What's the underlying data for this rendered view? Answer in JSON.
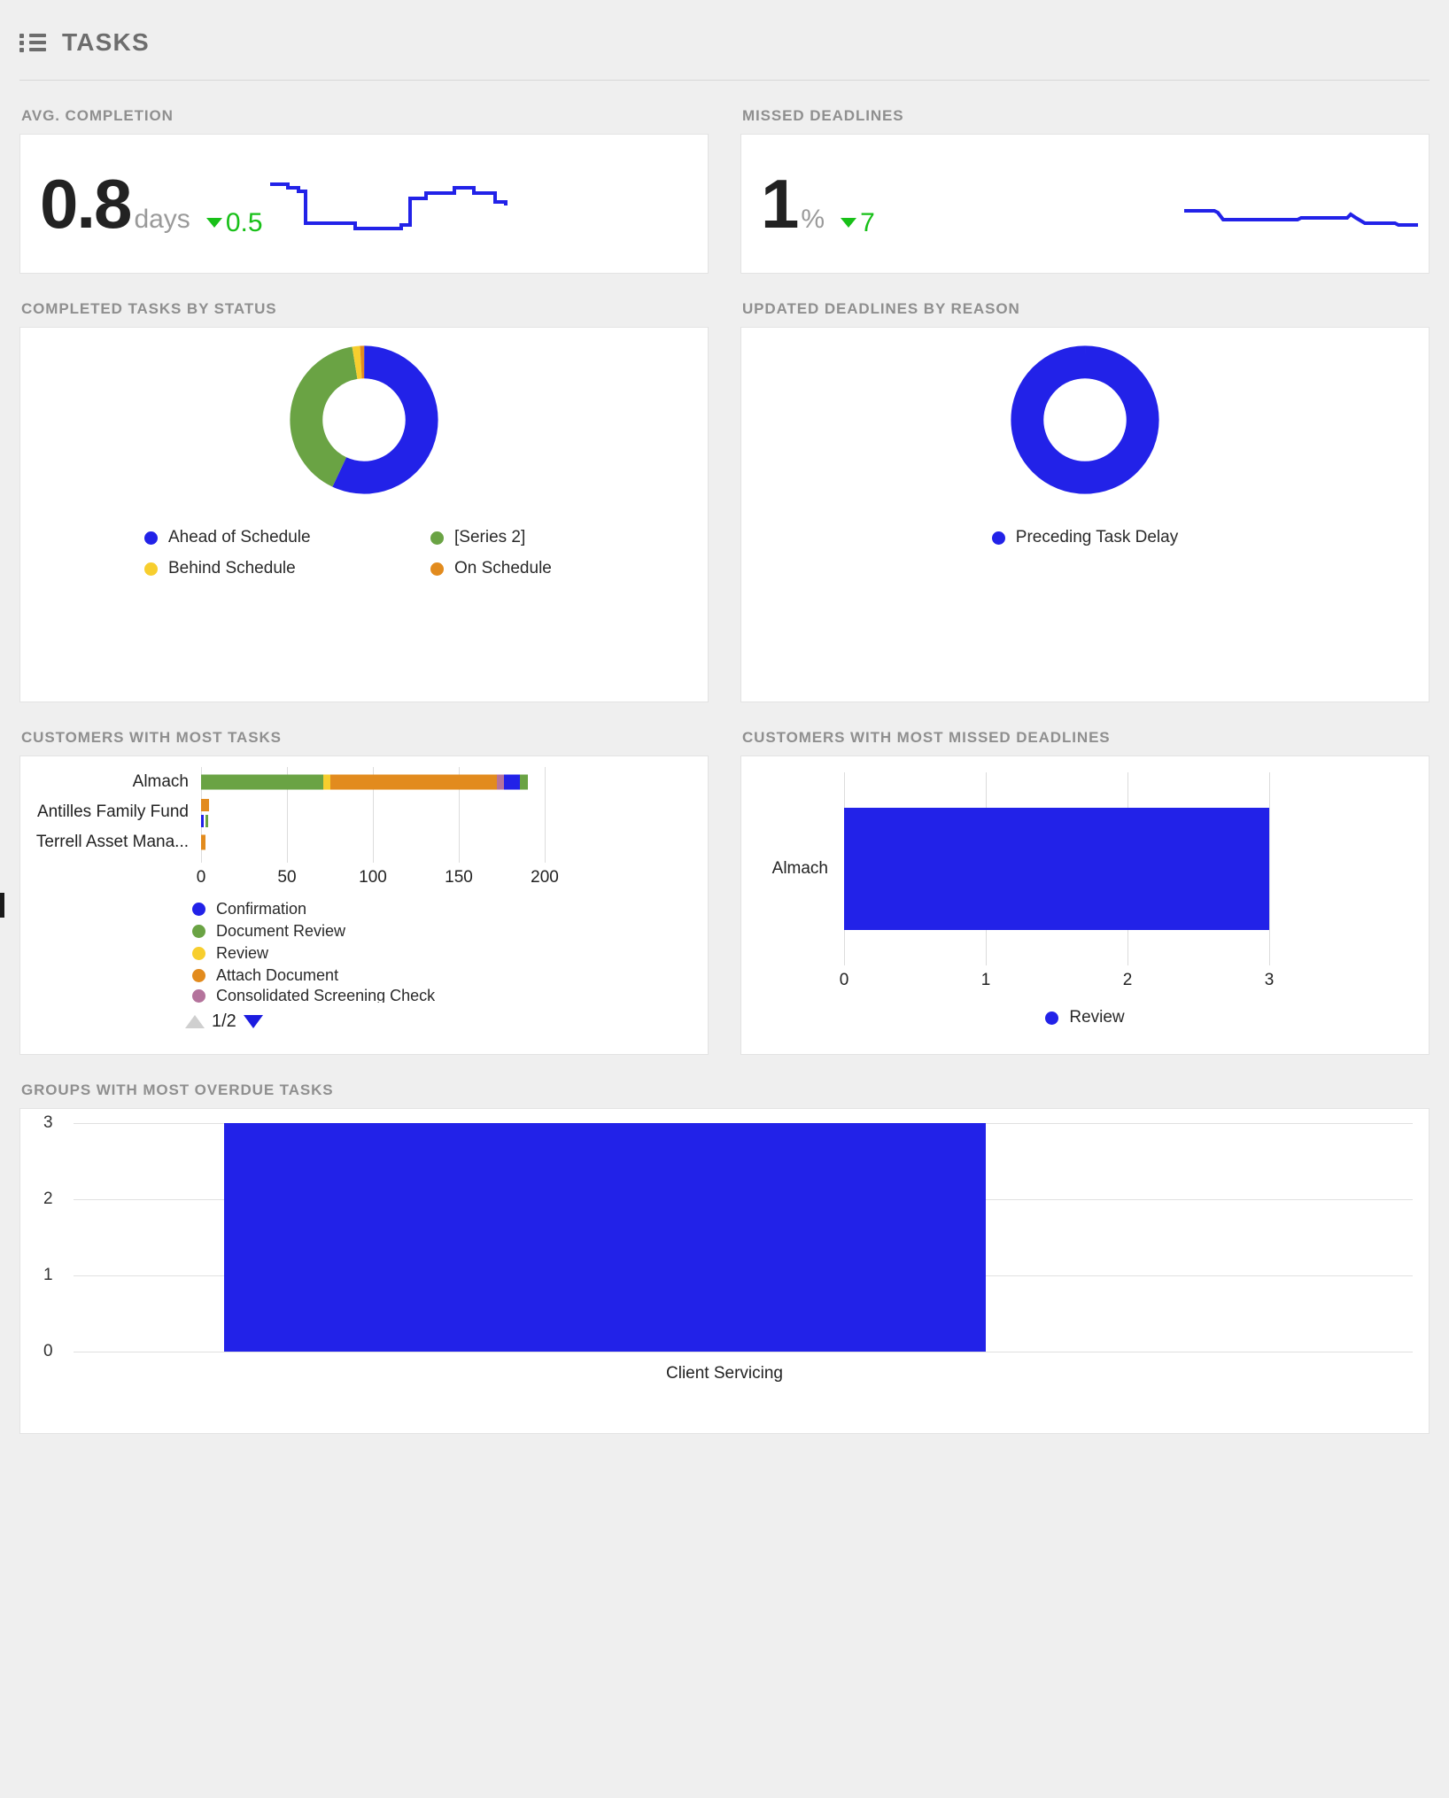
{
  "header": {
    "title": "TASKS",
    "icon": "list-icon"
  },
  "sections": {
    "avg_completion": "AVG. COMPLETION",
    "missed_deadlines": "MISSED DEADLINES",
    "completed_by_status": "COMPLETED TASKS BY STATUS",
    "updated_by_reason": "UPDATED DEADLINES BY REASON",
    "customers_most_tasks": "CUSTOMERS WITH MOST TASKS",
    "customers_most_missed": "CUSTOMERS WITH MOST MISSED DEADLINES",
    "groups_most_overdue": "GROUPS WITH MOST OVERDUE TASKS"
  },
  "kpi_avg_completion": {
    "value": "0.8",
    "unit": "days",
    "delta": "0.5",
    "delta_direction": "down",
    "delta_color": "#18c018"
  },
  "kpi_missed_deadlines": {
    "value": "1",
    "unit": "%",
    "delta": "7",
    "delta_direction": "down",
    "delta_color": "#18c018"
  },
  "colors": {
    "blue": "#2222e8",
    "green": "#66a council",
    "series_blue": "#2222e8",
    "series_green": "#6aa344",
    "series_yellow": "#f7ce2e",
    "series_orange": "#e28b1e",
    "series_mauve": "#b4739c",
    "grey": "#8f8f8f"
  },
  "chart_data": [
    {
      "id": "avg-completion-sparkline",
      "type": "line",
      "title": "AVG. COMPLETION",
      "xlabel": "",
      "ylabel": "",
      "grid": false,
      "legend": "none",
      "series": [
        {
          "name": "Avg. Completion",
          "color": "#2222e8",
          "values": [
            0.86,
            0.86,
            0.86,
            0.82,
            0.82,
            0.35,
            0.35,
            0.35,
            0.35,
            0.3,
            0.3,
            0.3,
            0.3,
            0.32,
            0.32,
            0.72,
            0.72,
            0.76,
            0.76,
            0.76,
            0.82,
            0.82,
            0.78,
            0.78,
            0.78,
            0.78,
            0.62,
            0.62,
            0.58,
            0.58,
            0.58,
            0.58
          ]
        }
      ],
      "ylim": [
        0.2,
        1.0
      ]
    },
    {
      "id": "missed-deadlines-sparkline",
      "type": "line",
      "title": "MISSED DEADLINES",
      "xlabel": "",
      "ylabel": "",
      "grid": false,
      "legend": "none",
      "series": [
        {
          "name": "Missed Deadlines",
          "color": "#2222e8",
          "values": [
            0.62,
            0.62,
            0.62,
            0.6,
            0.44,
            0.44,
            0.44,
            0.44,
            0.44,
            0.44,
            0.44,
            0.44,
            0.5,
            0.5,
            0.5,
            0.56,
            0.46,
            0.42,
            0.42,
            0.42,
            0.38,
            0.38,
            0.38,
            0.38
          ]
        }
      ],
      "ylim": [
        0,
        1
      ]
    },
    {
      "id": "completed-tasks-by-status",
      "type": "pie",
      "variant": "donut",
      "title": "COMPLETED TASKS BY STATUS",
      "legend": "bottom",
      "labels": [
        "Ahead of Schedule",
        "[Series 2]",
        "Behind Schedule",
        "On Schedule"
      ],
      "colors": [
        "#2222e8",
        "#6aa344",
        "#f7ce2e",
        "#e28b1e"
      ],
      "values": [
        57.0,
        40.4,
        1.7,
        0.9
      ]
    },
    {
      "id": "updated-deadlines-by-reason",
      "type": "pie",
      "variant": "donut",
      "title": "UPDATED DEADLINES BY REASON",
      "legend": "bottom",
      "labels": [
        "Preceding Task Delay"
      ],
      "colors": [
        "#2222e8"
      ],
      "values": [
        100
      ]
    },
    {
      "id": "customers-with-most-tasks",
      "type": "bar",
      "orientation": "horizontal",
      "stacked": true,
      "title": "CUSTOMERS WITH MOST TASKS",
      "xlabel": "",
      "ylabel": "",
      "categories": [
        "Almach",
        "Antilles Family Fund",
        "Terrell Asset Mana..."
      ],
      "xticks": [
        "0",
        "50",
        "100",
        "150",
        "200"
      ],
      "xlim": [
        0,
        200
      ],
      "legend": "bottom",
      "page": "1/2",
      "series": [
        {
          "name": "Confirmation",
          "color": "#2222e8",
          "values": [
            9,
            1,
            0
          ]
        },
        {
          "name": "Document Review",
          "color": "#6aa344",
          "values": [
            71,
            1,
            0
          ]
        },
        {
          "name": "Review",
          "color": "#f7ce2e",
          "values": [
            4,
            0,
            0
          ]
        },
        {
          "name": "Attach Document",
          "color": "#e28b1e",
          "values": [
            97,
            2,
            2
          ]
        },
        {
          "name": "Consolidated Screening Check",
          "color": "#b4739c",
          "values": [
            4,
            0,
            0
          ]
        }
      ]
    },
    {
      "id": "customers-with-most-missed-deadlines",
      "type": "bar",
      "orientation": "horizontal",
      "title": "CUSTOMERS WITH MOST MISSED DEADLINES",
      "categories": [
        "Almach"
      ],
      "xticks": [
        "0",
        "1",
        "2",
        "3"
      ],
      "xlim": [
        0,
        3
      ],
      "legend": "bottom",
      "series": [
        {
          "name": "Review",
          "color": "#2222e8",
          "values": [
            3
          ]
        }
      ]
    },
    {
      "id": "groups-with-most-overdue-tasks",
      "type": "bar",
      "orientation": "vertical",
      "title": "GROUPS WITH MOST OVERDUE TASKS",
      "categories": [
        "Client Servicing"
      ],
      "yticks": [
        "0",
        "1",
        "2",
        "3"
      ],
      "ylim": [
        0,
        3
      ],
      "grid": true,
      "legend": "none",
      "series": [
        {
          "name": "Overdue Tasks",
          "color": "#2222e8",
          "values": [
            3
          ]
        }
      ]
    }
  ]
}
